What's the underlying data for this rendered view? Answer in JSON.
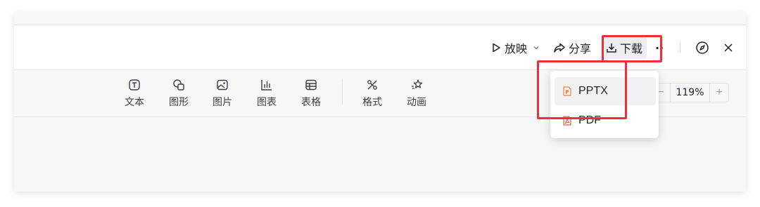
{
  "header": {
    "present_label": "放映",
    "share_label": "分享",
    "download_label": "下载",
    "more_label": "··"
  },
  "toolbar": {
    "tools": [
      {
        "label": "文本",
        "icon": "text-icon"
      },
      {
        "label": "图形",
        "icon": "shape-icon"
      },
      {
        "label": "图片",
        "icon": "image-icon"
      },
      {
        "label": "图表",
        "icon": "chart-icon"
      },
      {
        "label": "表格",
        "icon": "table-icon"
      },
      {
        "label": "格式",
        "icon": "format-icon"
      },
      {
        "label": "动画",
        "icon": "animation-icon"
      }
    ]
  },
  "zoom": {
    "minus": "−",
    "value": "119%",
    "plus": "+"
  },
  "download_menu": {
    "items": [
      {
        "label": "PPTX",
        "icon": "pptx-file-icon",
        "icon_color": "#f26b1d"
      },
      {
        "label": "PDF",
        "icon": "pdf-file-icon",
        "icon_color": "#e0393e"
      }
    ]
  },
  "colors": {
    "highlight_red": "#ee2f38",
    "background": "#f7f7f8"
  }
}
